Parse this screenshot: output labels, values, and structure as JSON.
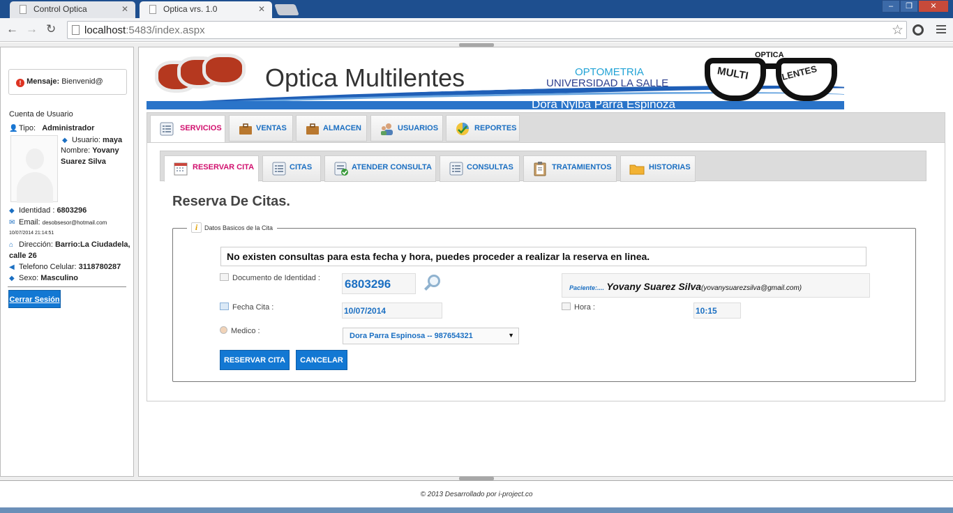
{
  "browser": {
    "tabs": [
      {
        "title": "Control Optica",
        "active": false
      },
      {
        "title": "Optica vrs. 1.0",
        "active": true
      }
    ],
    "url_host": "localhost",
    "url_rest": ":5483/index.aspx"
  },
  "sidebar": {
    "message_label": "Mensaje:",
    "message_text": "Bienvenid@",
    "account_heading": "Cuenta de Usuario",
    "tipo_label": "Tipo:",
    "tipo_value": "Administrador",
    "usuario_label": "Usuario:",
    "usuario_value": "maya",
    "nombre_label": "Nombre:",
    "nombre_value_1": "Yovany",
    "nombre_value_2": "Suarez Silva",
    "identidad_label": "Identidad :",
    "identidad_value": "6803296",
    "email_label": "Email:",
    "email_value": "desobsesor@hotmail.com",
    "timestamp": "10/07/2014 21:14:51",
    "direccion_label": "Dirección:",
    "direccion_value_1": "Barrio:La Ciudadela,",
    "direccion_value_2": "calle 26",
    "telefono_label": "Telefono Celular:",
    "telefono_value": "3118780287",
    "sexo_label": "Sexo:",
    "sexo_value": "Masculino",
    "logout_label": "Cerrar Sesión"
  },
  "banner": {
    "brand": "Optica Multilentes",
    "line1": "OPTOMETRIA",
    "line2": "UNIVERSIDAD LA SALLE",
    "line3": "Dora Nylba Parra Espinoza",
    "logo_top": "OPTICA",
    "logo_left": "MULTI",
    "logo_right": "LENTES"
  },
  "main_tabs": [
    "SERVICIOS",
    "VENTAS",
    "ALMACEN",
    "USUARIOS",
    "REPORTES"
  ],
  "sub_tabs": [
    "RESERVAR CITA",
    "CITAS",
    "ATENDER CONSULTA",
    "CONSULTAS",
    "TRATAMIENTOS",
    "HISTORIAS"
  ],
  "form": {
    "title": "Reserva De Citas.",
    "legend": "Datos Basicos de la Cita",
    "notice": "No existen consultas para esta fecha y hora, puedes proceder a realizar la reserva en linea.",
    "documento_label": "Documento de Identidad :",
    "documento_value": "6803296",
    "paciente_label": "Paciente:....",
    "paciente_name": "Yovany Suarez Silva",
    "paciente_email": "(yovanysuarezsilva@gmail.com)",
    "fecha_label": "Fecha Cita :",
    "fecha_value": "10/07/2014",
    "hora_label": "Hora :",
    "hora_value": "10:15",
    "medico_label": "Medico :",
    "medico_value": "Dora Parra Espinosa -- 987654321",
    "reservar_button": "RESERVAR CITA",
    "cancelar_button": "CANCELAR"
  },
  "footer": {
    "text": "© 2013   Desarrollado por i-project.co"
  },
  "colors": {
    "accent_blue": "#1b6fc2",
    "active_tab_pink": "#d1106e",
    "button_blue": "#1378d3"
  }
}
